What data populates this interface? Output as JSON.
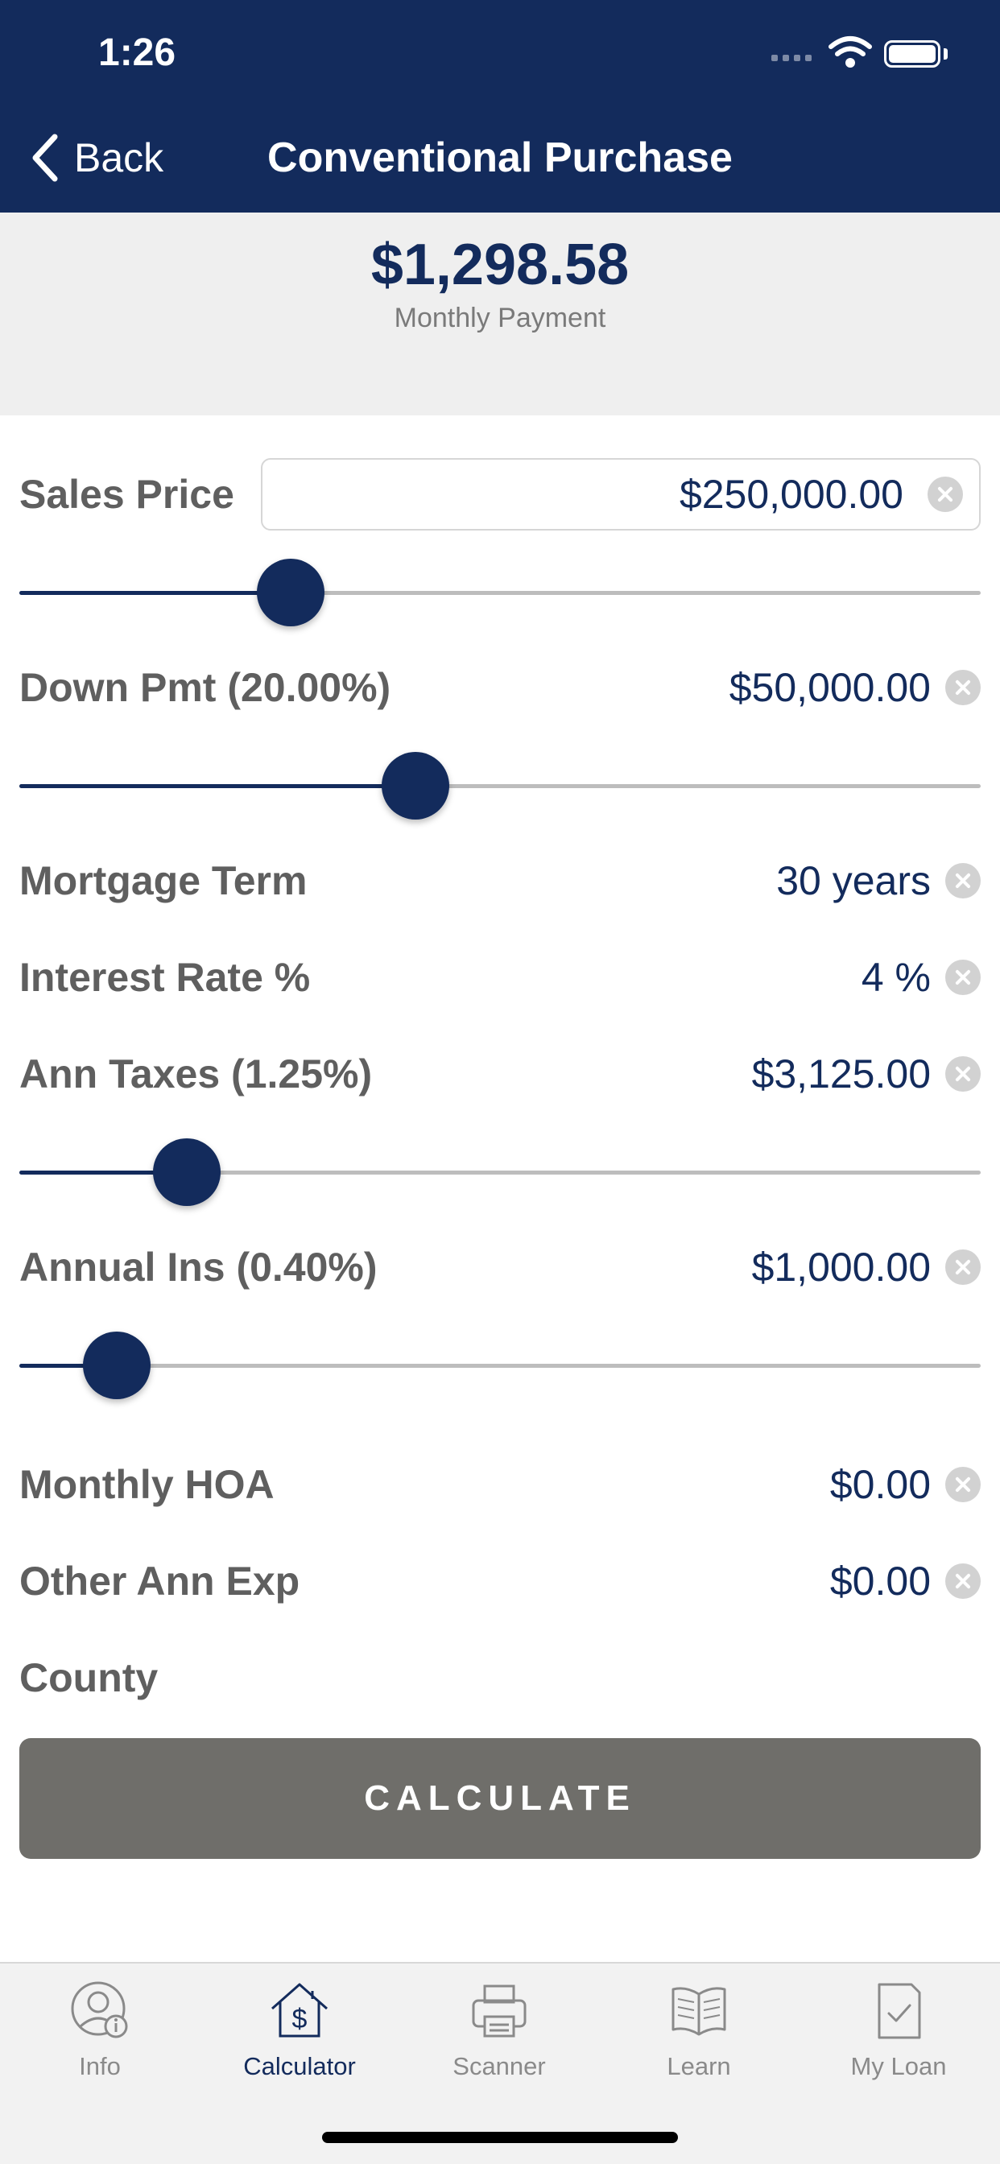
{
  "status_bar": {
    "time": "1:26"
  },
  "nav": {
    "back_label": "Back",
    "title": "Conventional Purchase"
  },
  "summary": {
    "amount": "$1,298.58",
    "label": "Monthly Payment"
  },
  "sales_price": {
    "label": "Sales Price",
    "value": "$250,000.00",
    "slider_fraction": 0.282
  },
  "down_payment": {
    "label": "Down Pmt (20.00%)",
    "value": "$50,000.00",
    "slider_fraction": 0.412
  },
  "mortgage_term": {
    "label": "Mortgage Term",
    "value": "30 years"
  },
  "interest_rate": {
    "label": "Interest Rate %",
    "value": "4 %"
  },
  "ann_taxes": {
    "label": "Ann Taxes (1.25%)",
    "value": "$3,125.00",
    "slider_fraction": 0.174
  },
  "annual_ins": {
    "label": "Annual Ins (0.40%)",
    "value": "$1,000.00",
    "slider_fraction": 0.101
  },
  "monthly_hoa": {
    "label": "Monthly HOA",
    "value": "$0.00"
  },
  "other_ann_exp": {
    "label": "Other Ann Exp",
    "value": "$0.00"
  },
  "county": {
    "label": "County"
  },
  "calculate_label": "CALCULATE",
  "tabs": [
    {
      "label": "Info",
      "icon": "person-info-icon"
    },
    {
      "label": "Calculator",
      "icon": "house-dollar-icon",
      "active": true
    },
    {
      "label": "Scanner",
      "icon": "printer-icon"
    },
    {
      "label": "Learn",
      "icon": "book-icon"
    },
    {
      "label": "My Loan",
      "icon": "document-check-icon"
    }
  ],
  "colors": {
    "navy": "#132b5c",
    "button_gray": "#6f6e6a",
    "tab_bg": "#f2f2f2",
    "summary_bg": "#efefef"
  }
}
